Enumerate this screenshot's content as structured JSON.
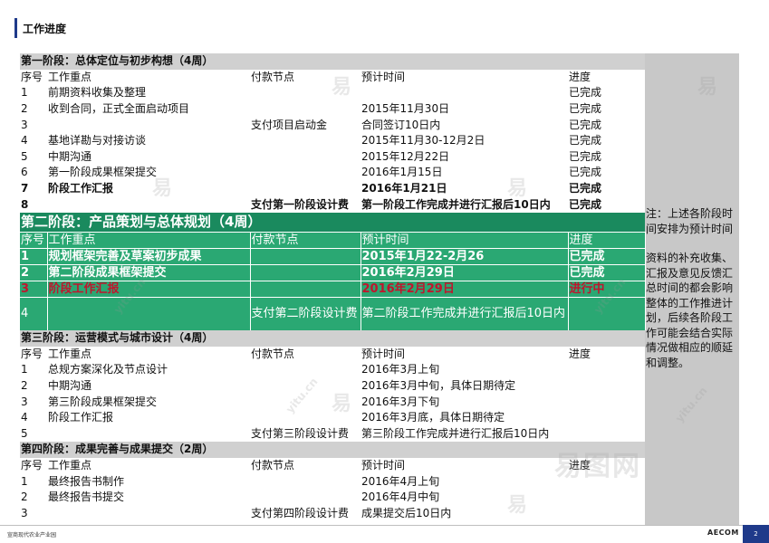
{
  "header": {
    "title": "工作进度"
  },
  "phase1": {
    "title": "第一阶段：总体定位与初步构想（4周）",
    "columns": [
      "序号",
      "工作重点",
      "付款节点",
      "预计时间",
      "进度"
    ],
    "rows": [
      [
        "1",
        "前期资料收集及整理",
        "",
        "",
        "已完成"
      ],
      [
        "2",
        "收到合同，正式全面启动项目",
        "",
        "2015年11月30日",
        "已完成"
      ],
      [
        "3",
        "",
        "支付项目启动金",
        "合同签订10日内",
        "已完成"
      ],
      [
        "4",
        "基地详勘与对接访谈",
        "",
        "2015年11月30-12月2日",
        "已完成"
      ],
      [
        "5",
        "中期沟通",
        "",
        "2015年12月22日",
        "已完成"
      ],
      [
        "6",
        "第一阶段成果框架提交",
        "",
        "2016年1月15日",
        "已完成"
      ],
      [
        "7",
        "阶段工作汇报",
        "",
        "2016年1月21日",
        "已完成"
      ],
      [
        "8",
        "",
        "支付第一阶段设计费",
        "第一阶段工作完成并进行汇报后10日内",
        "已完成"
      ]
    ]
  },
  "phase2": {
    "title": "第二阶段：产品策划与总体规划（4周）",
    "columns": [
      "序号",
      "工作重点",
      "付款节点",
      "预计时间",
      "进度"
    ],
    "rows": [
      [
        "1",
        "规划框架完善及草案初步成果",
        "",
        "2015年1月22-2月26",
        "已完成"
      ],
      [
        "2",
        "第二阶段成果框架提交",
        "",
        "2016年2月29日",
        "已完成"
      ],
      [
        "3",
        "阶段工作汇报",
        "",
        "2016年2月29日",
        "进行中"
      ],
      [
        "4",
        "",
        "支付第二阶段设计费",
        "第二阶段工作完成并进行汇报后10日内",
        ""
      ]
    ]
  },
  "phase3": {
    "title": "第三阶段：运营模式与城市设计（4周）",
    "columns": [
      "序号",
      "工作重点",
      "付款节点",
      "预计时间",
      "进度"
    ],
    "rows": [
      [
        "1",
        "总规方案深化及节点设计",
        "",
        "2016年3月上旬",
        ""
      ],
      [
        "2",
        "中期沟通",
        "",
        "2016年3月中旬，具体日期待定",
        ""
      ],
      [
        "3",
        "第三阶段成果框架提交",
        "",
        "2016年3月下旬",
        ""
      ],
      [
        "4",
        "阶段工作汇报",
        "",
        "2016年3月底，具体日期待定",
        ""
      ],
      [
        "5",
        "",
        "支付第三阶段设计费",
        "第三阶段工作完成并进行汇报后10日内",
        ""
      ]
    ]
  },
  "phase4": {
    "title": "第四阶段：成果完善与成果提交（2周）",
    "columns": [
      "序号",
      "工作重点",
      "付款节点",
      "预计时间",
      "进度"
    ],
    "rows": [
      [
        "1",
        "最终报告书制作",
        "",
        "2016年4月上旬",
        ""
      ],
      [
        "2",
        "最终报告书提交",
        "",
        "2016年4月中旬",
        ""
      ],
      [
        "3",
        "",
        "支付第四阶段设计费",
        "成果提交后10日内",
        ""
      ]
    ]
  },
  "note": {
    "para1": "注：上述各阶段时间安排为预计时间",
    "para2": "资料的补充收集、汇报及意见反馈汇总时间的都会影响整体的工作推进计划，后续各阶段工作可能会结合实际情况做相应的顺延和调整。"
  },
  "watermarks": {
    "yi": "易",
    "yitu": "yitu.cn",
    "big": "易图网"
  },
  "footer": {
    "project": "宣商现代农业产业园",
    "logo": "AECOM",
    "page": "2"
  },
  "colors": {
    "accent": "#1f3a8a",
    "phase2_title": "#1a8a5e",
    "phase2_row": "#2aa873",
    "red": "#c0152d",
    "gray": "#d0d0d0"
  }
}
